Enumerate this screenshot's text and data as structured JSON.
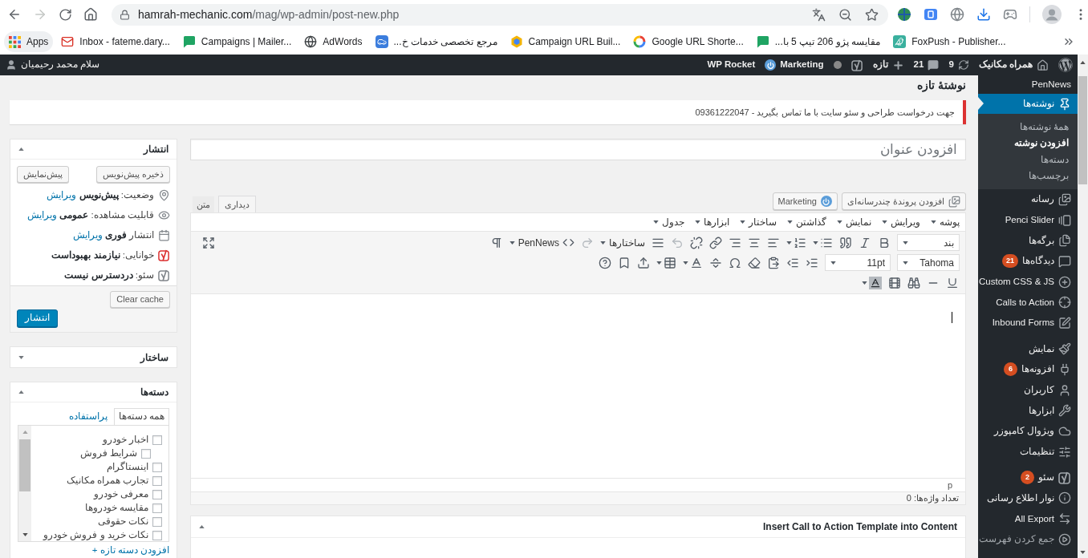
{
  "browser": {
    "url_host": "hamrah-mechanic.com",
    "url_path": "/mag/wp-admin/post-new.php",
    "bookmarks": [
      {
        "label": "FoxPush - Publisher..."
      },
      {
        "label": "مقایسه پژو 206 تیپ 5 با..."
      },
      {
        "label": "Google URL Shorte..."
      },
      {
        "label": "Campaign URL Buil..."
      },
      {
        "label": "مرجع تخصصی خدمات خ..."
      },
      {
        "label": "AdWords"
      },
      {
        "label": "Campaigns | Mailer..."
      },
      {
        "label": "Inbox - fateme.dary..."
      },
      {
        "label": "Apps"
      }
    ]
  },
  "admin_bar": {
    "site": "همراه مکانیک",
    "updates": "9",
    "comments": "21",
    "new": "تازه",
    "marketing": "Marketing",
    "rocket": "WP Rocket",
    "greeting": "سلام محمد رحیمیان"
  },
  "admin_menu": {
    "groups": [
      {
        "items": [
          {
            "label": "PenNews",
            "selected": false
          },
          {
            "label": "نوشته‌ها",
            "selected": true,
            "submenu": [
              {
                "label": "همهٔ نوشته‌ها",
                "selected": false
              },
              {
                "label": "افزودن نوشته",
                "selected": true
              },
              {
                "label": "دسته‌ها",
                "selected": false
              },
              {
                "label": "برچسب‌ها",
                "selected": false
              }
            ]
          },
          {
            "label": "رسانه",
            "selected": false
          },
          {
            "label": "Penci Slider",
            "selected": false
          },
          {
            "label": "برگه‌ها",
            "selected": false
          },
          {
            "label": "دیدگاه‌ها",
            "selected": false,
            "count": "21"
          },
          {
            "label": "Custom CSS & JS",
            "selected": false
          },
          {
            "label": "Calls to Action",
            "selected": false
          },
          {
            "label": "Inbound Forms",
            "selected": false
          }
        ]
      },
      {
        "items": [
          {
            "label": "نمایش",
            "selected": false
          },
          {
            "label": "افزونه‌ها",
            "selected": false,
            "count": "6"
          },
          {
            "label": "کاربران",
            "selected": false
          },
          {
            "label": "ابزارها",
            "selected": false
          },
          {
            "label": "ویژوال کامپوزر",
            "selected": false
          },
          {
            "label": "تنظیمات",
            "selected": false
          }
        ]
      },
      {
        "items": [
          {
            "label": "سئو",
            "selected": false,
            "count": "2"
          },
          {
            "label": "نوار اطلاع رسانی",
            "selected": false
          },
          {
            "label": "All Export",
            "selected": false
          }
        ]
      }
    ],
    "collapse": "جمع کردن فهرست"
  },
  "page": {
    "title": "نوشتهٔ تازه",
    "notice": "جهت درخواست طراحی و سئو سایت با ما تماس بگیرید - 09361222047"
  },
  "post_title": {
    "placeholder": "افزودن عنوان"
  },
  "media_buttons": {
    "add_media": "افزودن پروندهٔ چندرسانه‌ای",
    "marketing": "Marketing"
  },
  "editor": {
    "tabs": [
      {
        "label": "دیداری",
        "selected": true
      },
      {
        "label": "متن",
        "selected": false
      }
    ],
    "menubar": [
      "پوشه",
      "ویرایش",
      "نمایش",
      "گذاشتن",
      "ساختار",
      "ابزارها",
      "جدول"
    ],
    "toolbar": {
      "block_format": "بند",
      "formats": "ساختارها",
      "shortcodes": "PenNews",
      "font_family": "Tahoma",
      "font_size": "11pt",
      "undo_disabled": true,
      "redo_disabled": true
    },
    "path": "p",
    "word_count": "تعداد واژه‌ها: 0"
  },
  "cta_box": {
    "title": "Insert Call to Action Template into Content",
    "expanded": true
  },
  "publish_box": {
    "title": "انتشار",
    "expanded": true,
    "save_draft": "ذخیره پیش‌نویس",
    "preview": "پیش‌نمایش",
    "rows": [
      {
        "label": "وضعیت:",
        "value": "پیش‌نویس",
        "link": "ویرایش",
        "color": "#82878c"
      },
      {
        "label": "قابلیت مشاهده:",
        "value": "عمومی",
        "link": "ویرایش",
        "color": "#82878c"
      },
      {
        "label": "انتشار",
        "value": "فوری",
        "link": "ویرایش",
        "color": "#82878c"
      },
      {
        "label": "خوانایی:",
        "value": "نیازمند بهبوداست",
        "color": "#dc3232"
      },
      {
        "label": "سئو:",
        "value": "دردسترس نیست",
        "color": "#82878c"
      }
    ],
    "clear_cache": "Clear cache",
    "publish": "انتشار"
  },
  "structure_box": {
    "title": "ساختار",
    "expanded": false
  },
  "categories_box": {
    "title": "دسته‌ها",
    "expanded": true,
    "tabs": [
      {
        "label": "همه دسته‌ها",
        "selected": true
      },
      {
        "label": "پراستفاده",
        "selected": false
      }
    ],
    "items": [
      {
        "label": "اخبار خودرو",
        "checked": false,
        "children": [
          {
            "label": "شرایط فروش",
            "checked": false
          }
        ]
      },
      {
        "label": "اینستاگرام",
        "checked": false
      },
      {
        "label": "تجارب همراه مکانیک",
        "checked": false
      },
      {
        "label": "معرفی خودرو",
        "checked": false
      },
      {
        "label": "مقایسه خودروها",
        "checked": false
      },
      {
        "label": "نکات حقوقی",
        "checked": false
      },
      {
        "label": "نکات خرید و فروش خودرو",
        "checked": false
      }
    ],
    "add_new": "+ افزودن دسته تازه"
  }
}
